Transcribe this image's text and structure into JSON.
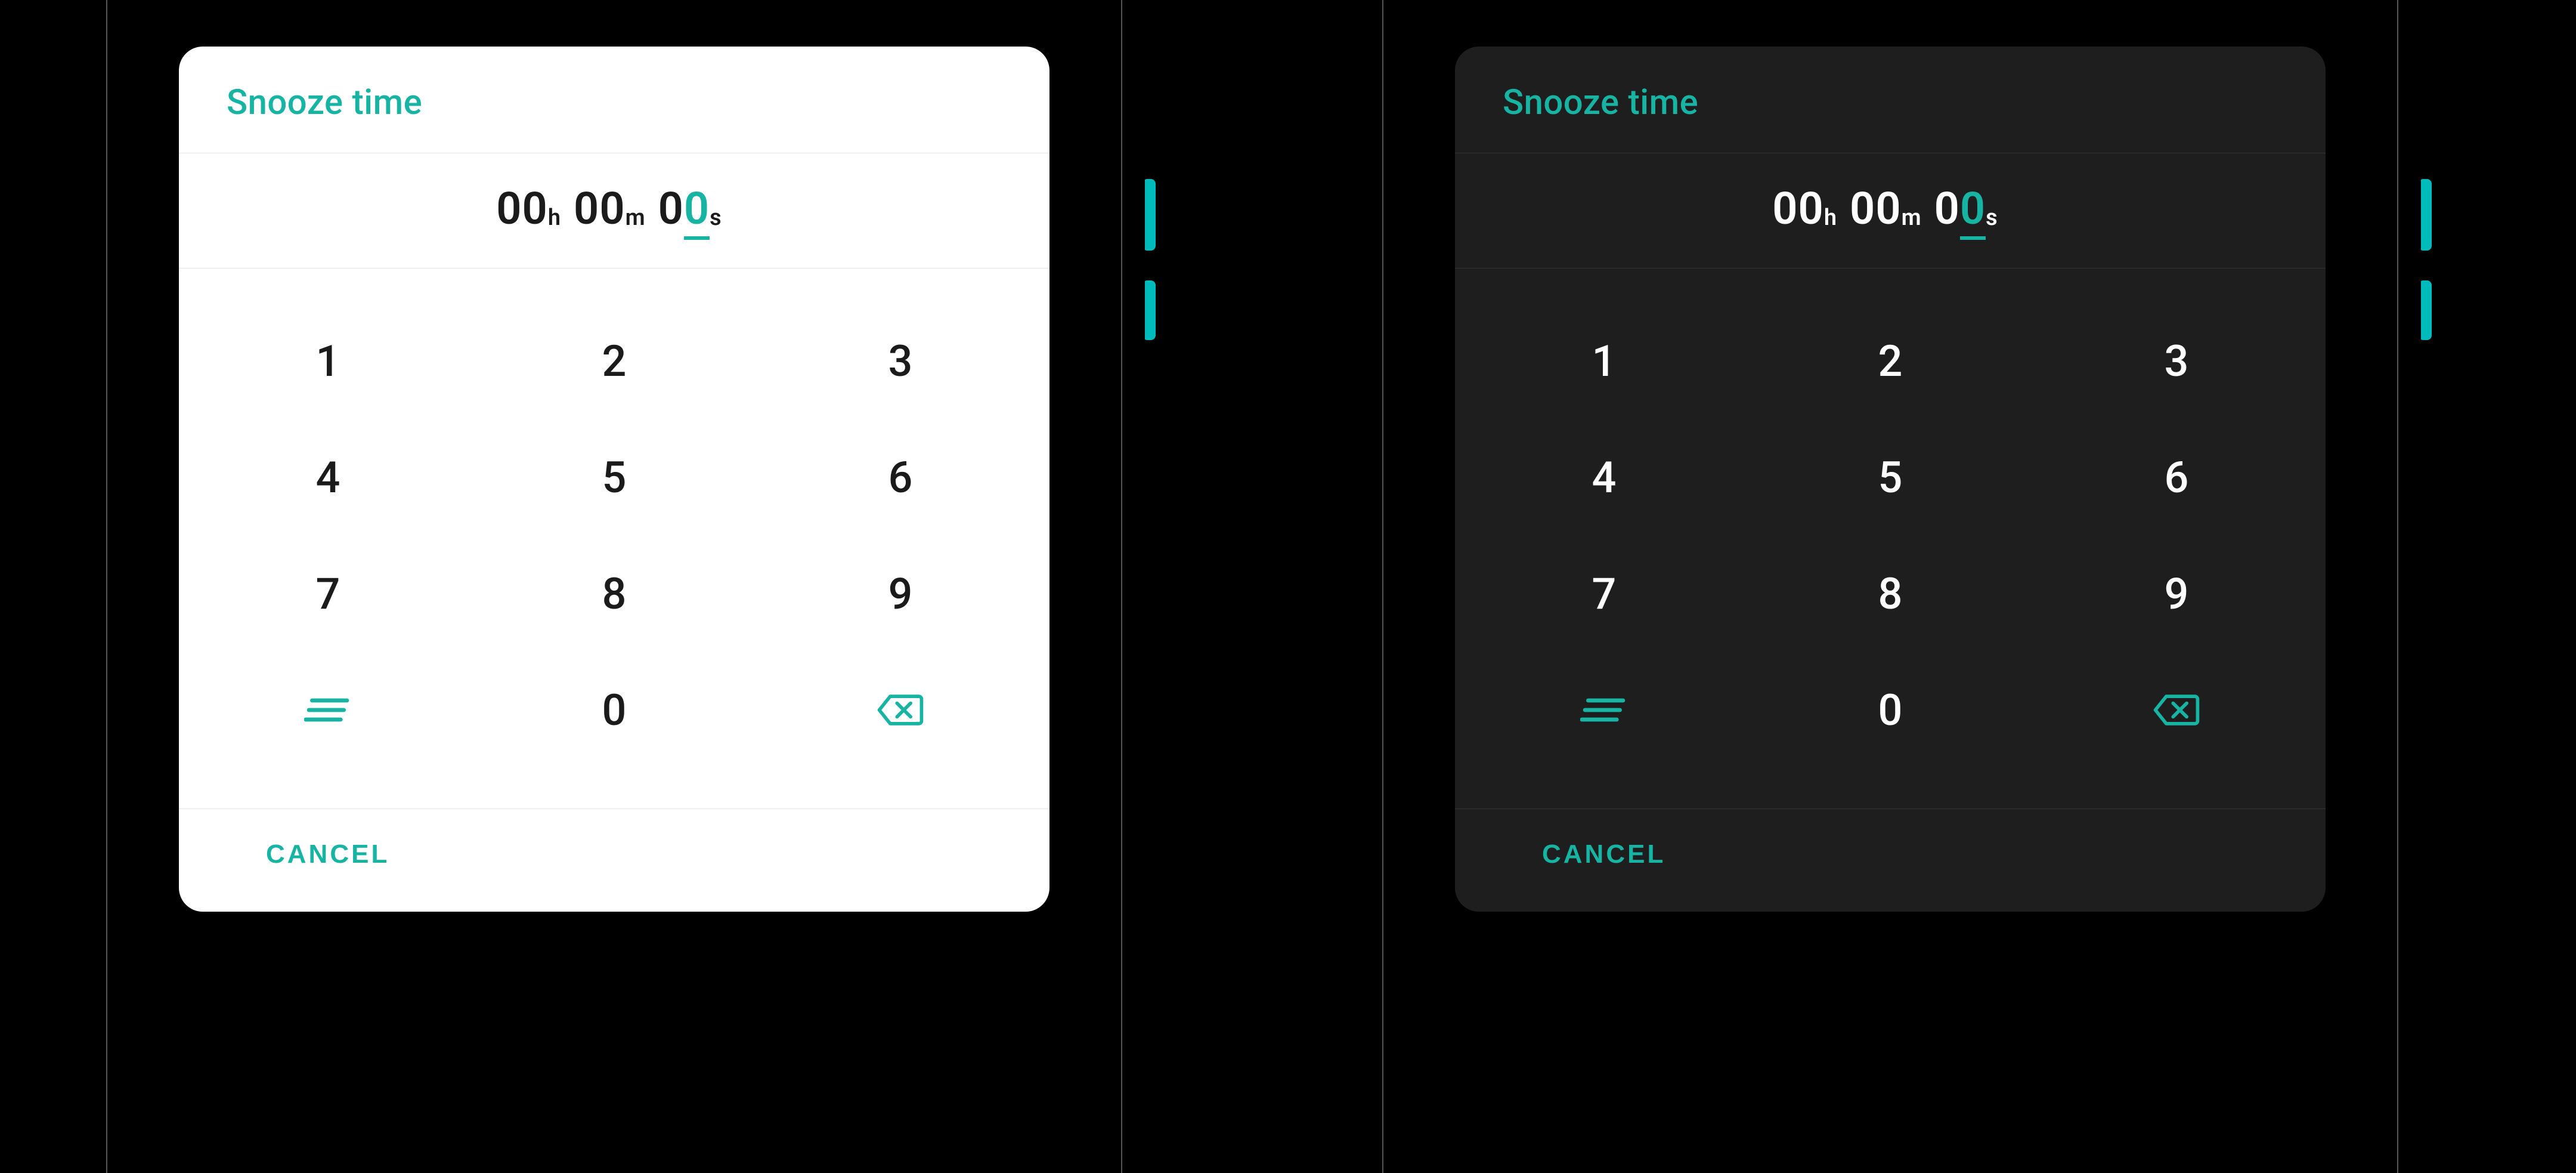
{
  "accent": "#17b3a3",
  "dialog": {
    "title": "Snooze time",
    "time": {
      "hours": "00",
      "hours_unit": "h",
      "minutes": "00",
      "minutes_unit": "m",
      "seconds_prefix": "0",
      "seconds_active": "0",
      "seconds_unit": "s"
    },
    "keypad": {
      "k1": "1",
      "k2": "2",
      "k3": "3",
      "k4": "4",
      "k5": "5",
      "k6": "6",
      "k7": "7",
      "k8": "8",
      "k9": "9",
      "k0": "0",
      "swap_icon": "swap-icon",
      "backspace_icon": "backspace-icon"
    },
    "actions": {
      "cancel": "CANCEL"
    }
  }
}
